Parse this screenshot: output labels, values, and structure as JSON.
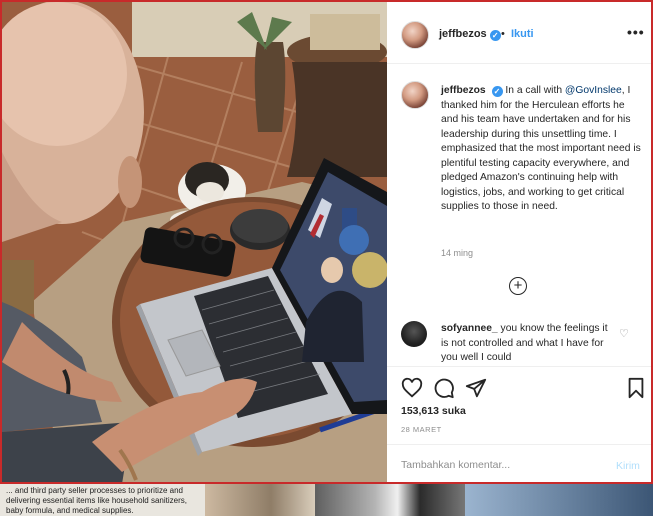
{
  "post": {
    "username": "jeffbezos",
    "verified_mark": "✓",
    "separator": "•",
    "follow_label": "Ikuti",
    "more_label": "•••"
  },
  "caption": {
    "username": "jeffbezos",
    "pre": "In a call with ",
    "mention": "@GovInslee",
    "post": ", I thanked him for the Herculean efforts he and his team have undertaken and for his leadership during this unsettling time. I emphasized that the most important need is plentiful testing capacity everywhere, and pledged Amazon's continuing help with logistics, jobs, and working to get critical supplies to those in need.",
    "time": "14 ming"
  },
  "load_more_symbol": "+",
  "comments": [
    {
      "username": "sofyannee_",
      "text": "you know the feelings it is not controlled and what I have for you well I could",
      "like_icon": "heart-outline-icon"
    }
  ],
  "actions": {
    "icons": [
      "heart-icon",
      "comment-icon",
      "share-icon",
      "bookmark-icon"
    ],
    "likes": "153,613 suka",
    "date": "28 MARET"
  },
  "comment_box": {
    "placeholder": "Tambahkan komentar...",
    "post_label": "Kirim"
  },
  "background": {
    "article_text": "... and third party seller processes to prioritize and delivering essential items like household sanitizers, baby formula, and medical supplies."
  },
  "colors": {
    "accent_blue": "#3897f0",
    "modal_border": "#c82a2a",
    "post_disabled": "#b2dffc",
    "muted_text": "#8e8e8e"
  }
}
